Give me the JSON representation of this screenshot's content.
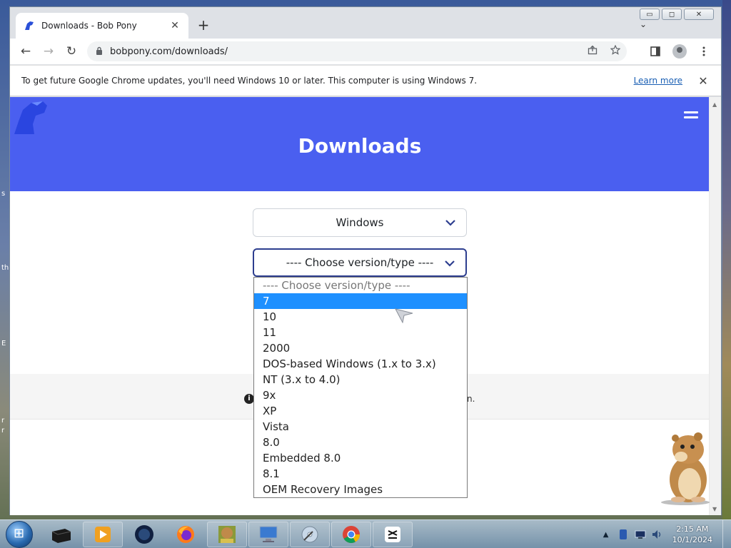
{
  "desktop": {
    "edge_texts": [
      "s",
      "th",
      "E",
      "r",
      "r"
    ]
  },
  "browser": {
    "tab": {
      "title": "Downloads - Bob Pony",
      "close": "✕"
    },
    "new_tab": "+",
    "tab_search": "⌄",
    "window_controls": {
      "minimize": "▭",
      "maximize": "◻",
      "close": "✕"
    },
    "toolbar": {
      "back": "←",
      "forward": "→",
      "reload": "↻",
      "url": "bobpony.com/downloads/"
    },
    "infobar": {
      "message": "To get future Google Chrome updates, you'll need Windows 10 or later. This computer is using Windows 7.",
      "link": "Learn more",
      "close": "✕"
    }
  },
  "page": {
    "hero_title": "Downloads",
    "os_select": {
      "value": "Windows"
    },
    "version_select": {
      "value": "---- Choose version/type ----",
      "options": [
        "---- Choose version/type ----",
        "7",
        "10",
        "11",
        "2000",
        "DOS-based Windows (1.x to 3.x)",
        "NT (3.x to 4.0)",
        "9x",
        "XP",
        "Vista",
        "8.0",
        "Embedded 8.0",
        "8.1",
        "OEM Recovery Images"
      ],
      "highlighted_index": 1
    },
    "band_tail": "n."
  },
  "taskbar": {
    "clock_time": "2:15 AM",
    "clock_date": "10/1/2024"
  },
  "colors": {
    "hero": "#4a5ff0",
    "highlight": "#1e90ff",
    "focus_border": "#2d3e8f"
  }
}
